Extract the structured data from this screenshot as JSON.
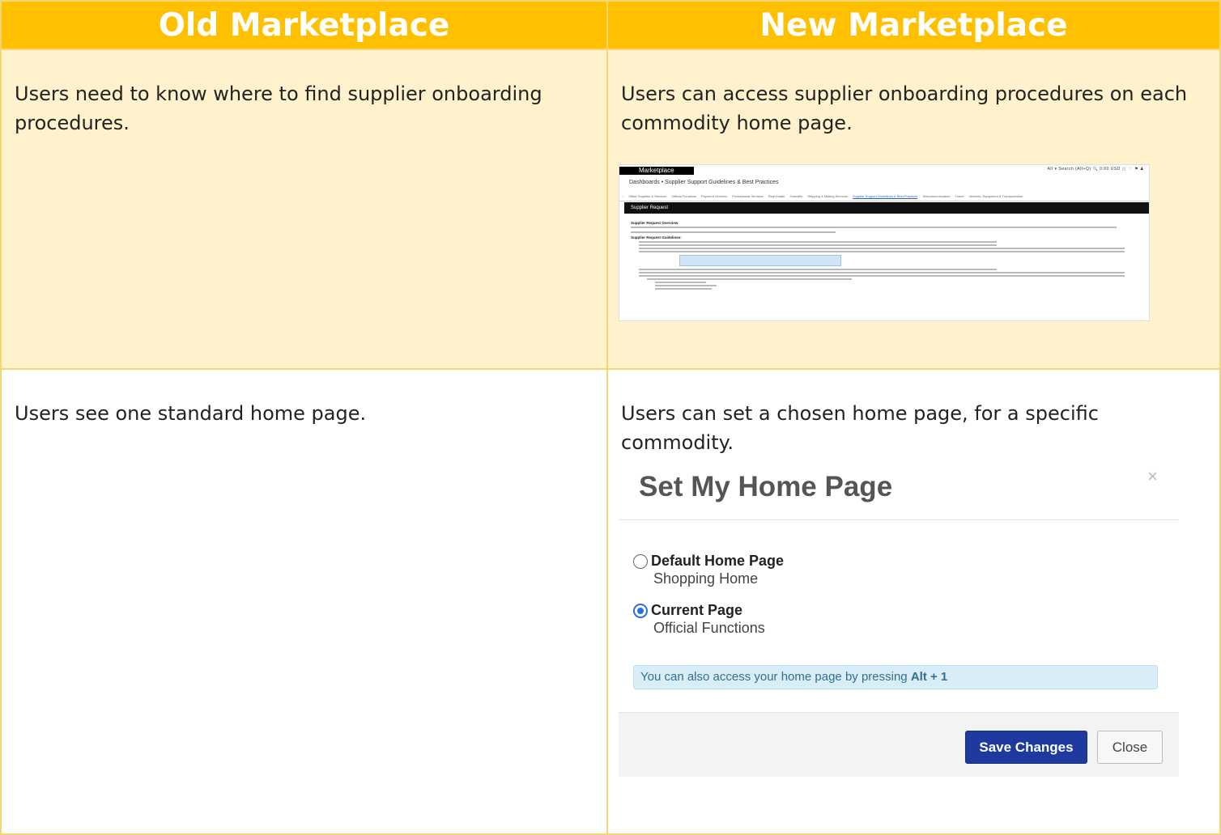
{
  "header": {
    "old": "Old Marketplace",
    "new": "New Marketplace"
  },
  "rows": [
    {
      "old_text": "Users need to know where to find supplier onboarding procedures.",
      "new_text": "Users can access supplier onboarding procedures on each commodity home page."
    },
    {
      "old_text": "Users see one standard home page.",
      "new_text": "Users can set a chosen home page, for a specific commodity."
    }
  ],
  "thumbnail": {
    "brand": "Marketplace",
    "utility": "All ▾   Search (Alt+Q)   🔍   0.00 USD  🛒   ♡  ⚑   ♟",
    "breadcrumb": "Dashboards  •  Supplier Support Guidelines & Best Practices",
    "tabs": [
      "Office Supplies & Services",
      "Official Functions",
      "Payment Services",
      "Professional Services",
      "Real Estate",
      "Scientific",
      "Shipping & Mailing Services",
      "Supplier Support Guidelines & Best Practices",
      "Telecommunication",
      "Travel",
      "Vehicles, Equipment & Transportation"
    ],
    "bar_title": "Supplier Request",
    "overview_heading": "Supplier Request Overview",
    "guidelines_heading": "Supplier Request Guidelines:"
  },
  "dialog": {
    "title": "Set My Home Page",
    "close_icon": "×",
    "options": [
      {
        "label": "Default Home Page",
        "sub": "Shopping Home",
        "selected": false
      },
      {
        "label": "Current Page",
        "sub": "Official Functions",
        "selected": true
      }
    ],
    "info_text": "You can also access your home page by pressing ",
    "info_key": "Alt + 1",
    "save_label": "Save Changes",
    "close_label": "Close"
  },
  "colors": {
    "header_bg": "#ffc000",
    "row1_bg": "#fff2cc",
    "border": "#f5d675",
    "save_button": "#1f3a9e"
  }
}
